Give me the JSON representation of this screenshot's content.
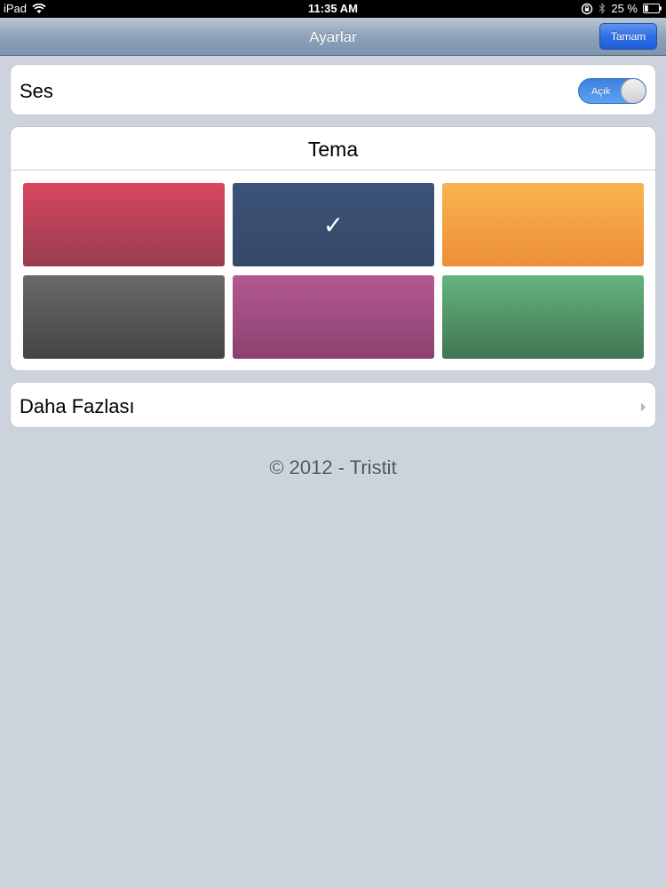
{
  "status_bar": {
    "device": "iPad",
    "time": "11:35 AM",
    "battery_label": "25 %",
    "battery_level": 0.25,
    "icons": [
      "wifi-icon",
      "rotation-lock-icon",
      "bluetooth-icon",
      "battery-icon"
    ]
  },
  "nav": {
    "title": "Ayarlar",
    "done_label": "Tamam"
  },
  "sound": {
    "label": "Ses",
    "toggle_label": "Açık",
    "on": true
  },
  "theme": {
    "title": "Tema",
    "selected_index": 1,
    "check_glyph": "✓",
    "swatches": [
      {
        "color": "#d9475f"
      },
      {
        "color": "#3c5377"
      },
      {
        "color": "#f8b54d"
      },
      {
        "color": "#6b6a69"
      },
      {
        "color": "#b45a91"
      },
      {
        "color": "#62b57d"
      }
    ]
  },
  "more": {
    "label": "Daha Fazlası",
    "icon": "chevron-right-icon"
  },
  "footer": {
    "text": "© 2012 - Tristit"
  },
  "colors": {
    "background": "#cdd3dc",
    "accent": "#2e6fe8"
  }
}
